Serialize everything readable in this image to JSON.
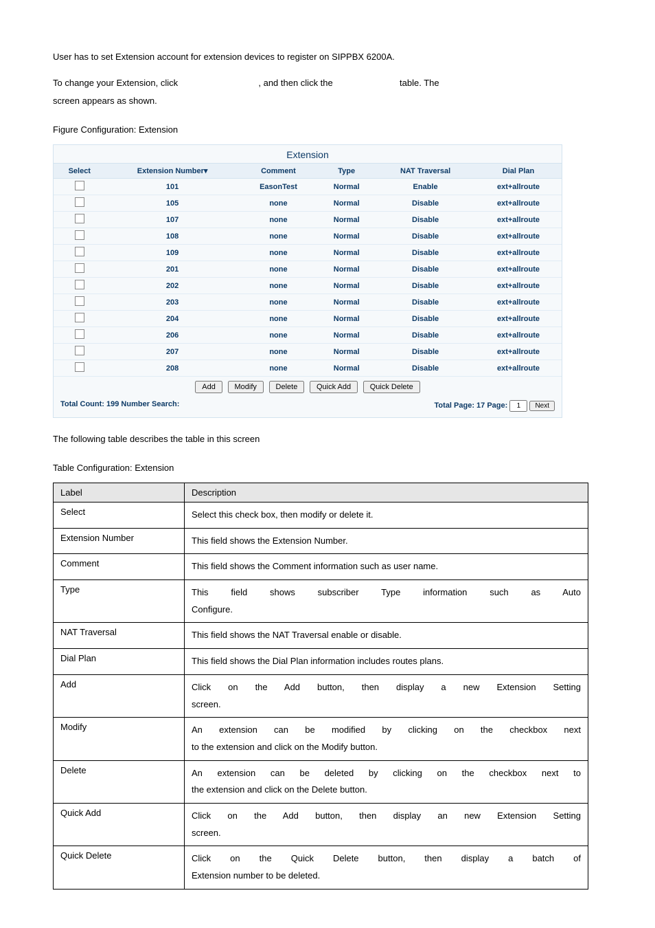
{
  "intro": {
    "line1": "User has to set Extension account for extension devices to register on SIPPBX 6200A.",
    "line2a": "To change your Extension, click",
    "line2b": ", and then click the",
    "line2c": "table. The",
    "line3": "screen appears as shown."
  },
  "figureCaption": "Figure Configuration: Extension",
  "panel": {
    "title": "Extension",
    "headers": {
      "select": "Select",
      "extno": "Extension Number▾",
      "comment": "Comment",
      "type": "Type",
      "nat": "NAT Traversal",
      "dial": "Dial Plan"
    },
    "rows": [
      {
        "no": "101",
        "comment": "EasonTest",
        "type": "Normal",
        "nat": "Enable",
        "dial": "ext+allroute"
      },
      {
        "no": "105",
        "comment": "none",
        "type": "Normal",
        "nat": "Disable",
        "dial": "ext+allroute"
      },
      {
        "no": "107",
        "comment": "none",
        "type": "Normal",
        "nat": "Disable",
        "dial": "ext+allroute"
      },
      {
        "no": "108",
        "comment": "none",
        "type": "Normal",
        "nat": "Disable",
        "dial": "ext+allroute"
      },
      {
        "no": "109",
        "comment": "none",
        "type": "Normal",
        "nat": "Disable",
        "dial": "ext+allroute"
      },
      {
        "no": "201",
        "comment": "none",
        "type": "Normal",
        "nat": "Disable",
        "dial": "ext+allroute"
      },
      {
        "no": "202",
        "comment": "none",
        "type": "Normal",
        "nat": "Disable",
        "dial": "ext+allroute"
      },
      {
        "no": "203",
        "comment": "none",
        "type": "Normal",
        "nat": "Disable",
        "dial": "ext+allroute"
      },
      {
        "no": "204",
        "comment": "none",
        "type": "Normal",
        "nat": "Disable",
        "dial": "ext+allroute"
      },
      {
        "no": "206",
        "comment": "none",
        "type": "Normal",
        "nat": "Disable",
        "dial": "ext+allroute"
      },
      {
        "no": "207",
        "comment": "none",
        "type": "Normal",
        "nat": "Disable",
        "dial": "ext+allroute"
      },
      {
        "no": "208",
        "comment": "none",
        "type": "Normal",
        "nat": "Disable",
        "dial": "ext+allroute"
      }
    ],
    "buttons": {
      "add": "Add",
      "modify": "Modify",
      "delete": "Delete",
      "quickAdd": "Quick Add",
      "quickDelete": "Quick Delete"
    },
    "totals": {
      "left": "Total Count: 199  Number Search:",
      "rightA": "Total Page: 17  Page:",
      "page": "1",
      "next": "Next"
    }
  },
  "midText": "The following table describes the table in this screen",
  "tableCaption": "Table   Configuration: Extension",
  "desc": {
    "hLabel": "Label",
    "hDesc": "Description",
    "rows": [
      {
        "l": "Select",
        "d": "Select this check box, then modify or delete it."
      },
      {
        "l": "Extension Number",
        "d": "This field shows the Extension Number."
      },
      {
        "l": "Comment",
        "d": "This field shows the Comment information such as user name."
      },
      {
        "l": "Type",
        "d": "This field shows subscriber Type information such as Auto Configure.",
        "justifyFirst": true,
        "d1": "This field shows subscriber Type information such as Auto",
        "d2": "Configure."
      },
      {
        "l": "NAT Traversal",
        "d": "This field shows the NAT Traversal enable or disable."
      },
      {
        "l": "Dial Plan",
        "d": "This field shows the Dial Plan information includes routes plans."
      },
      {
        "l": "Add",
        "d1": "Click on the Add button, then display a new Extension Setting",
        "d2": "screen.",
        "justifyFirst": true
      },
      {
        "l": "Modify",
        "d1": "An extension can be modified by clicking on the checkbox next",
        "d2": "to the extension and click on the Modify button.",
        "justifyFirst": true
      },
      {
        "l": "Delete",
        "d1": "An extension can be deleted by clicking on the checkbox next to",
        "d2": "the extension and click on the Delete button.",
        "justifyFirst": true
      },
      {
        "l": "Quick Add",
        "d1": "Click on the Add button, then display an new Extension Setting",
        "d2": "screen.",
        "justifyFirst": true
      },
      {
        "l": "Quick Delete",
        "d1": "Click on the Quick Delete button, then display a batch of",
        "d2": "Extension number to be deleted.",
        "justifyFirst": true
      }
    ]
  }
}
